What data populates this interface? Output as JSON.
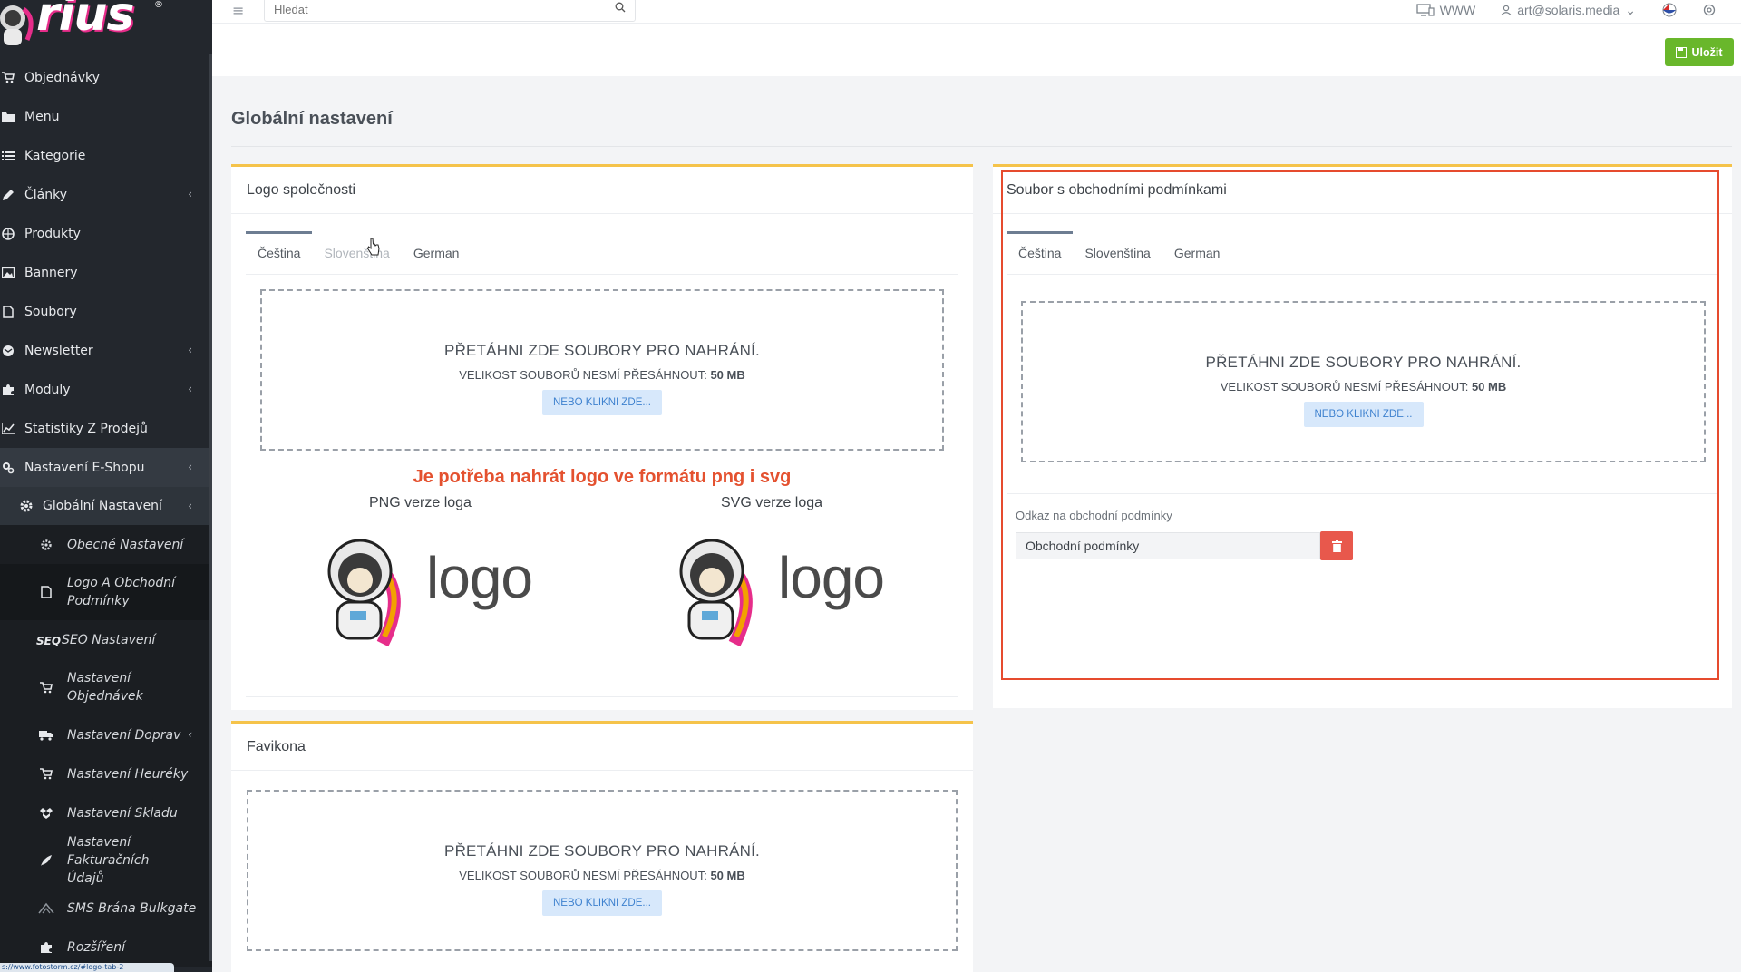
{
  "brand": {
    "logo_text": "rius",
    "reg_mark": "®"
  },
  "sidebar": {
    "items": [
      {
        "label": "Objednávky",
        "icon": "cart-icon",
        "chevron": false
      },
      {
        "label": "Menu",
        "icon": "folder-icon",
        "chevron": false
      },
      {
        "label": "Kategorie",
        "icon": "list-icon",
        "chevron": false
      },
      {
        "label": "Články",
        "icon": "pencil-icon",
        "chevron": true
      },
      {
        "label": "Produkty",
        "icon": "basketball-icon",
        "chevron": false
      },
      {
        "label": "Bannery",
        "icon": "image-icon",
        "chevron": false
      },
      {
        "label": "Soubory",
        "icon": "file-icon",
        "chevron": false
      },
      {
        "label": "Newsletter",
        "icon": "newsletter-icon",
        "chevron": true
      },
      {
        "label": "Moduly",
        "icon": "puzzle-icon",
        "chevron": true
      },
      {
        "label": "Statistiky Z Prodejů",
        "icon": "chart-icon",
        "chevron": false
      },
      {
        "label": "Nastavení E-Shopu",
        "icon": "cogs-icon",
        "chevron": true
      }
    ],
    "sub_open": {
      "label": "Globální Nastavení",
      "chevron": true
    },
    "sub_items": [
      {
        "label": "Obecné Nastavení",
        "icon": "gear-icon"
      },
      {
        "label": "Logo A Obchodní Podmínky",
        "icon": "file-icon"
      },
      {
        "label": "SEO Nastavení",
        "icon": "seo-icon"
      },
      {
        "label": "Nastavení Objednávek",
        "icon": "cart-icon"
      },
      {
        "label": "Nastavení Doprav",
        "icon": "truck-icon"
      },
      {
        "label": "Nastavení Heuréky",
        "icon": "cart-icon"
      },
      {
        "label": "Nastavení Skladu",
        "icon": "dropbox-icon"
      },
      {
        "label": "Nastavení Fakturačních Údajů",
        "icon": "feather-icon"
      },
      {
        "label": "SMS Brána Bulkgate",
        "icon": "sms-icon"
      },
      {
        "label": "Rozšíření",
        "icon": "puzzle-icon"
      }
    ],
    "status_url": "s://www.fotostorm.cz/#logo-tab-2"
  },
  "topbar": {
    "search_placeholder": "Hledat",
    "www_label": "WWW",
    "user_email": "art@solaris.media"
  },
  "toolbar": {
    "save_label": "Uložit"
  },
  "page": {
    "title": "Globální nastavení"
  },
  "dropzone": {
    "title": "PŘETÁHNI ZDE SOUBORY PRO NAHRÁNÍ.",
    "size_prefix": "VELIKOST SOUBORŮ NESMÍ PŘESÁHNOUT:",
    "size_value": "50 MB",
    "button": "NEBO KLIKNI ZDE..."
  },
  "logo_card": {
    "title": "Logo společnosti",
    "tabs": [
      "Čeština",
      "Slovenština",
      "German"
    ],
    "warning": "Je potřeba nahrát logo ve formátu png i svg",
    "png_label": "PNG verze loga",
    "svg_label": "SVG verze loga",
    "logo_word": "logo"
  },
  "terms_card": {
    "title": "Soubor s obchodními podmínkami",
    "tabs": [
      "Čeština",
      "Slovenština",
      "German"
    ],
    "link_label": "Odkaz na obchodní podmínky",
    "link_value": "Obchodní podmínky"
  },
  "favicon_card": {
    "title": "Favikona"
  },
  "colors": {
    "accent": "#f5c34a",
    "save": "#69b72b",
    "danger": "#e8584c",
    "warning_text": "#e4512f",
    "frame": "#e64b2e"
  }
}
